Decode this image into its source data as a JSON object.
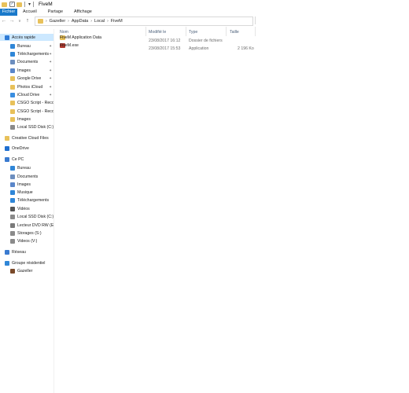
{
  "window": {
    "title": "FiveM"
  },
  "ribbon": {
    "tabs": [
      "Fichier",
      "Accueil",
      "Partage",
      "Affichage"
    ]
  },
  "address": {
    "crumbs": [
      "Gazeller",
      "AppData",
      "Local",
      "FiveM"
    ]
  },
  "sidebar": {
    "items": [
      {
        "label": "Accès rapide",
        "icon": "star-icon",
        "color": "#2e7bd6",
        "sel": true
      },
      {
        "label": "Bureau",
        "icon": "desktop-icon",
        "color": "#2f86d7",
        "pin": true
      },
      {
        "label": "Téléchargements",
        "icon": "download-icon",
        "color": "#2f86d7",
        "pin": true
      },
      {
        "label": "Documents",
        "icon": "documents-icon",
        "color": "#6c8ebf",
        "pin": true
      },
      {
        "label": "Images",
        "icon": "images-icon",
        "color": "#5a86c9",
        "pin": true
      },
      {
        "label": "Google Drive",
        "icon": "google-drive-icon",
        "color": "#e8c15a",
        "pin": true
      },
      {
        "label": "Photos iCloud",
        "icon": "photos-icloud-icon",
        "color": "#e8c15a",
        "pin": true
      },
      {
        "label": "iCloud Drive",
        "icon": "icloud-drive-icon",
        "color": "#3a8ee0",
        "pin": true
      },
      {
        "label": "CSGO Script - Recor",
        "icon": "folder-icon",
        "color": "#e8c15a"
      },
      {
        "label": "CSGO Script - Recor",
        "icon": "folder-icon",
        "color": "#e8c15a"
      },
      {
        "label": "Images",
        "icon": "folder-icon",
        "color": "#e8c15a"
      },
      {
        "label": "Local SSD Disk  (C:)",
        "icon": "drive-icon",
        "color": "#8a8a8a"
      },
      {
        "label": "Creative Cloud Files",
        "icon": "creative-cloud-icon",
        "color": "#e8c15a"
      },
      {
        "label": "OneDrive",
        "icon": "onedrive-icon",
        "color": "#1f6fd0"
      },
      {
        "label": "Ce PC",
        "icon": "computer-icon",
        "color": "#3a7bd0"
      },
      {
        "label": "Bureau",
        "icon": "desktop-icon",
        "color": "#2f86d7"
      },
      {
        "label": "Documents",
        "icon": "documents-icon",
        "color": "#6c8ebf"
      },
      {
        "label": "Images",
        "icon": "images-icon",
        "color": "#5a86c9"
      },
      {
        "label": "Musique",
        "icon": "music-icon",
        "color": "#2f86d7"
      },
      {
        "label": "Téléchargements",
        "icon": "download-icon",
        "color": "#2f86d7"
      },
      {
        "label": "Vidéos",
        "icon": "videos-icon",
        "color": "#555555"
      },
      {
        "label": "Local SSD Disk  (C:)",
        "icon": "drive-icon",
        "color": "#8a8a8a"
      },
      {
        "label": "Lecteur DVD RW (E:",
        "icon": "dvd-icon",
        "color": "#7a7a7a"
      },
      {
        "label": "Storages (S:)",
        "icon": "drive-icon",
        "color": "#8a8a8a"
      },
      {
        "label": "Videos  (V:)",
        "icon": "drive-icon",
        "color": "#8a8a8a"
      },
      {
        "label": "Réseau",
        "icon": "network-icon",
        "color": "#3a7bd0"
      },
      {
        "label": "Groupe résidentiel",
        "icon": "homegroup-icon",
        "color": "#2f86d7"
      },
      {
        "label": "Gazeller",
        "icon": "user-avatar-icon",
        "color": "#7a4a2a"
      }
    ]
  },
  "columns": {
    "name": "Nom",
    "modified": "Modifié le",
    "type": "Type",
    "size": "Taille"
  },
  "files": [
    {
      "name": "FiveM Application Data",
      "modified": "23/08/2017 16:12",
      "type": "Dossier de fichiers",
      "size": "",
      "icon": "folder-icon",
      "color": "#e8c15a"
    },
    {
      "name": "FiveM.exe",
      "modified": "23/08/2017 15:53",
      "type": "Application",
      "size": "2 196 Ko",
      "icon": "exe-icon",
      "color": "#b03a2e"
    }
  ]
}
